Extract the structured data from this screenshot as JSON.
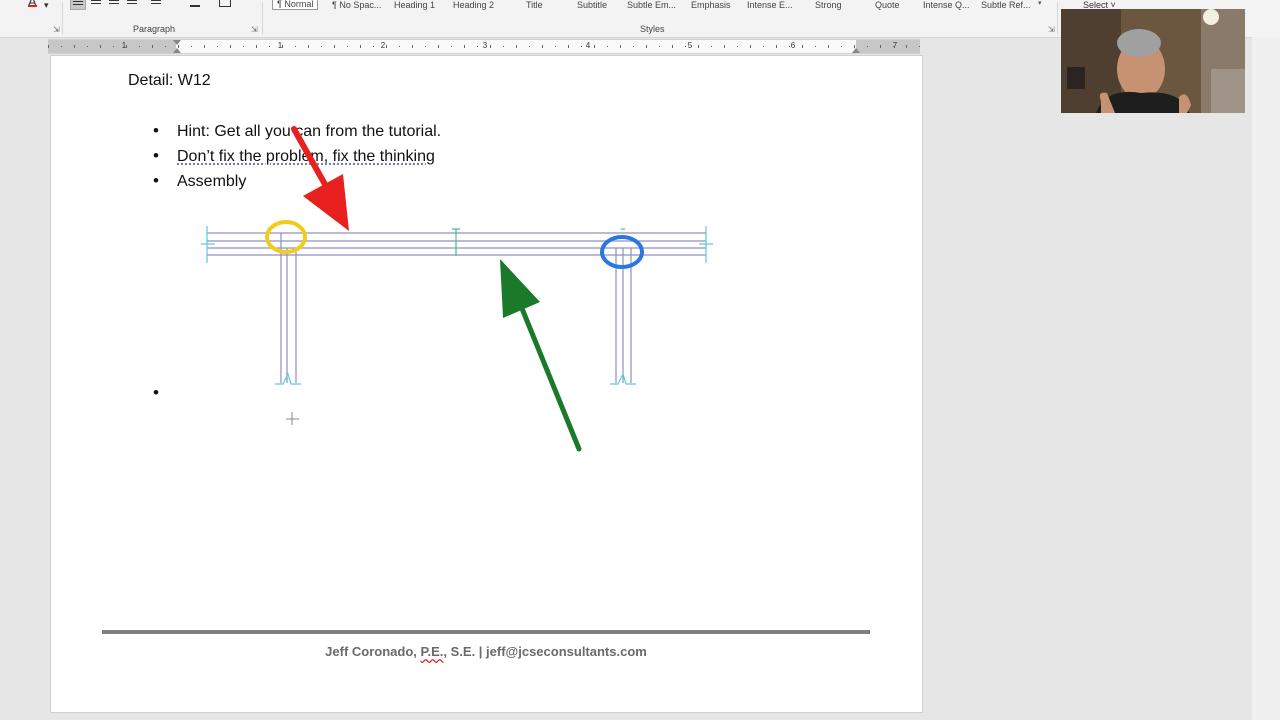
{
  "ribbon": {
    "paragraph_group_label": "Paragraph",
    "styles_group_label": "Styles",
    "styles": [
      "¶ Normal",
      "¶ No Spac...",
      "Heading 1",
      "Heading 2",
      "Title",
      "Subtitle",
      "Subtle Em...",
      "Emphasis",
      "Intense E...",
      "Strong",
      "Quote",
      "Intense Q...",
      "Subtle Ref..."
    ],
    "selected_style_index": 0,
    "select_button_label": "Select ˅",
    "font_color_glyph": "A"
  },
  "ruler": {
    "numbers": [
      "1",
      "1",
      "2",
      "3",
      "4",
      "5",
      "6",
      "7"
    ]
  },
  "document": {
    "heading": "Detail: W12",
    "bullets": [
      {
        "text": "Hint: Get all you can from the tutorial."
      },
      {
        "text": "Don’t fix the problem, fix the thinking"
      },
      {
        "text": "Assembly"
      }
    ],
    "empty_bullet_glyph": "•",
    "footer_name": "Jeff Coronado,",
    "footer_pe": "P.E.",
    "footer_rest": ", S.E. | jeff@jcseconsultants.com"
  },
  "annotations": {
    "red_arrow_color": "#e82020",
    "green_arrow_color": "#1a7a2a",
    "yellow_circle_color": "#f2cc1a",
    "blue_circle_color": "#2878e0",
    "drawing_line_color": "#9090c0",
    "dimension_color": "#5cc8e0"
  }
}
